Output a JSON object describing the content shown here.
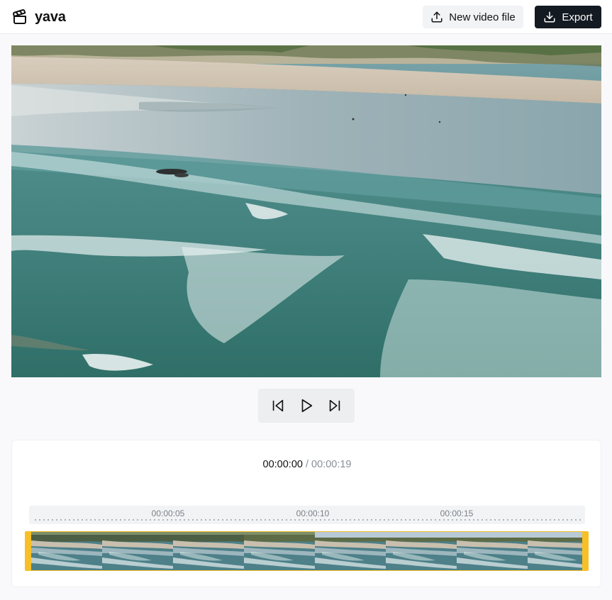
{
  "app": {
    "name": "yava"
  },
  "header": {
    "new_video_label": "New video file",
    "export_label": "Export"
  },
  "icons": {
    "brand": "clapperboard-icon",
    "new_video": "upload-icon",
    "export": "download-icon",
    "prev": "skip-back-icon",
    "play": "play-icon",
    "next": "skip-forward-icon"
  },
  "colors": {
    "accent_handle": "#f6c026",
    "export_bg": "#141a22"
  },
  "player": {
    "current_time": "00:00:00",
    "separator": "/",
    "total_time": "00:00:19"
  },
  "timeline": {
    "ruler_labels": [
      "00:00:05",
      "00:00:10",
      "00:00:15"
    ],
    "thumbnail_count": 8
  }
}
